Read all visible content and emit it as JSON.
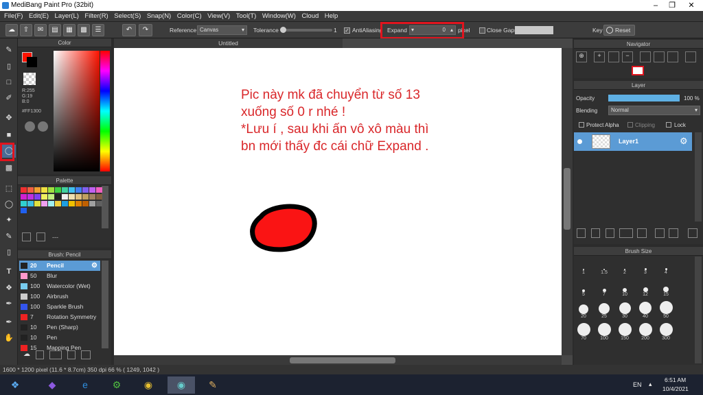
{
  "window": {
    "title": "MediBang Paint Pro (32bit)"
  },
  "menu": [
    "File(F)",
    "Edit(E)",
    "Layer(L)",
    "Filter(R)",
    "Select(S)",
    "Snap(N)",
    "Color(C)",
    "View(V)",
    "Tool(T)",
    "Window(W)",
    "Cloud",
    "Help"
  ],
  "toolbar": {
    "reference_label": "Reference",
    "reference_value": "Canvas",
    "tolerance_label": "Tolerance",
    "tolerance_value": "1",
    "antialiasing_label": "AntiAliasing",
    "expand_label": "Expand",
    "expand_value": "0",
    "expand_unit": "pixel",
    "close_gaps_label": "Close Gaps",
    "key_label": "Key",
    "reset_label": "Reset"
  },
  "color_panel": {
    "title": "Color",
    "r": "R:255",
    "g": "G:19",
    "b": "B:0",
    "hex": "#FF1300",
    "primary": "#ff1300"
  },
  "palette_panel": {
    "title": "Palette",
    "dash": "---"
  },
  "brush_panel": {
    "title": "Brush: Pencil",
    "items": [
      {
        "size": "20",
        "name": "Pencil",
        "color": "#222222"
      },
      {
        "size": "50",
        "name": "Blur",
        "color": "#ff99cc"
      },
      {
        "size": "100",
        "name": "Watercolor (Wet)",
        "color": "#77ccee"
      },
      {
        "size": "100",
        "name": "Airbrush",
        "color": "#cccccc"
      },
      {
        "size": "100",
        "name": "Sparkle Brush",
        "color": "#3355ee"
      },
      {
        "size": "7",
        "name": "Rotation Symmetry",
        "color": "#ee2222"
      },
      {
        "size": "10",
        "name": "Pen (Sharp)",
        "color": "#222222"
      },
      {
        "size": "10",
        "name": "Pen",
        "color": "#222222"
      },
      {
        "size": "15",
        "name": "Mapping Pen",
        "color": "#ee2222"
      }
    ]
  },
  "document": {
    "tab": "Untitled"
  },
  "annotation": {
    "line1": "Pic này mk đã chuyển từ số 13",
    "line2": "xuống số 0 r nhé !",
    "line3": "*Lưu í , sau khi ấn vô xô màu thì",
    "line4": "bn mới thấy đc cái chữ Expand ."
  },
  "navigator": {
    "title": "Navigator"
  },
  "layer_panel": {
    "title": "Layer",
    "opacity_label": "Opacity",
    "opacity_value": "100 %",
    "opacity_level": 1.0,
    "blending_label": "Blending",
    "blending_value": "Normal",
    "protect_alpha": "Protect Alpha",
    "clipping": "Clipping",
    "lock": "Lock",
    "layer_name": "Layer1"
  },
  "brush_size_panel": {
    "title": "Brush Size",
    "sizes": [
      "1",
      "1.5",
      "2",
      "3",
      "4",
      "5",
      "7",
      "10",
      "12",
      "15",
      "20",
      "25",
      "30",
      "40",
      "50",
      "70",
      "100",
      "150",
      "200",
      "300"
    ]
  },
  "status": {
    "text": "1600 * 1200 pixel   (11.6 * 8.7cm)   350 dpi   66 %   ( 1249, 1042 )"
  },
  "taskbar": {
    "lang": "EN",
    "time": "6:51 AM",
    "date": "10/4/2021"
  }
}
